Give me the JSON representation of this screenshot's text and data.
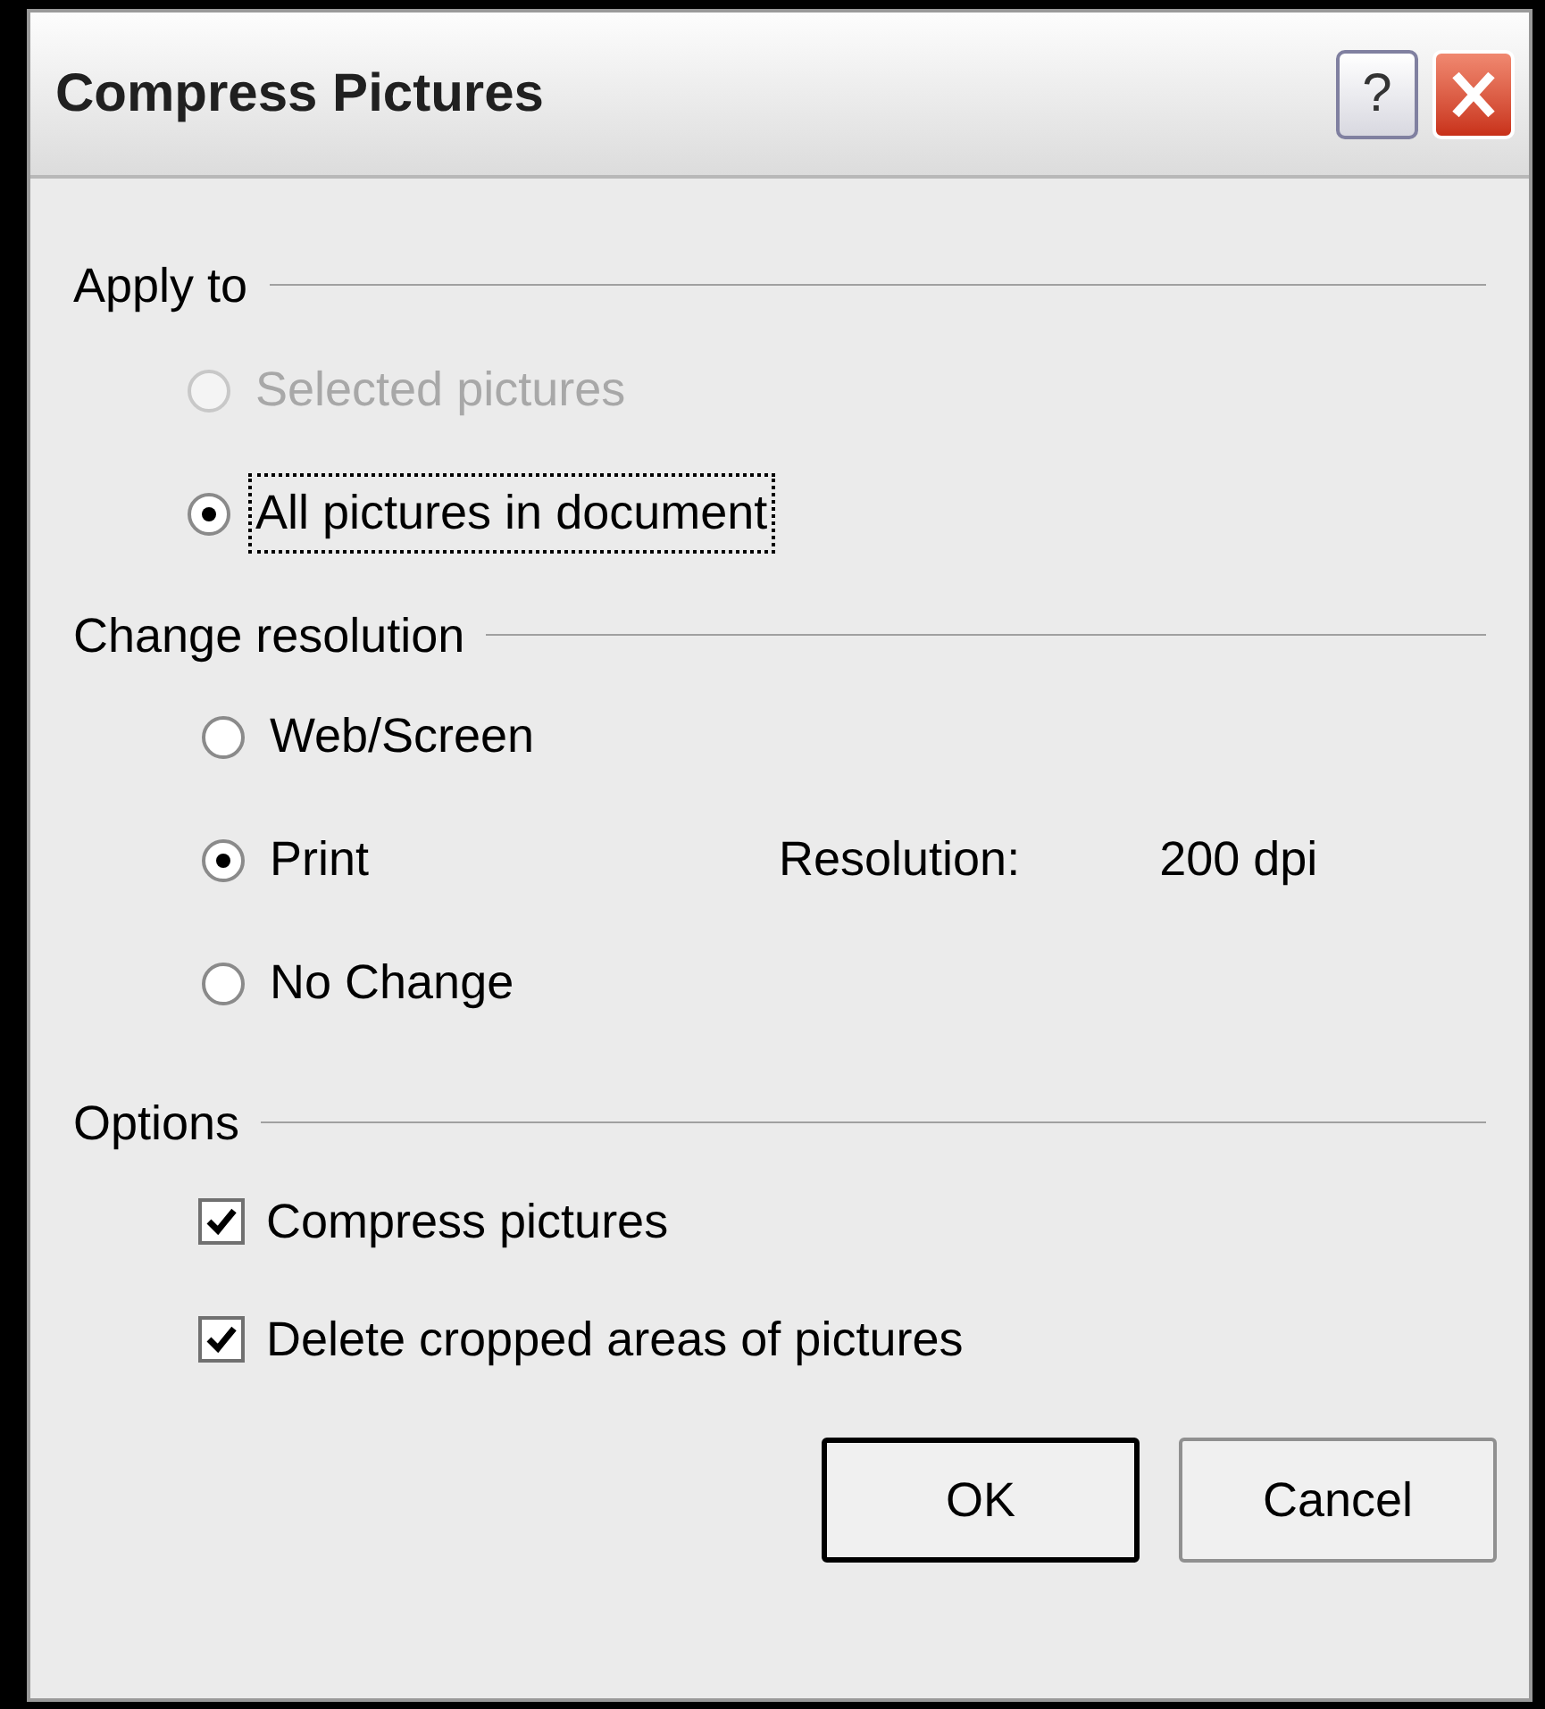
{
  "window": {
    "title": "Compress Pictures",
    "help_button": "?"
  },
  "apply_to": {
    "label": "Apply to",
    "options": [
      {
        "label": "Selected pictures",
        "selected": false,
        "disabled": true,
        "focused": false
      },
      {
        "label": "All pictures in document",
        "selected": true,
        "disabled": false,
        "focused": true
      }
    ]
  },
  "change_resolution": {
    "label": "Change resolution",
    "resolution_label": "Resolution:",
    "resolution_value": "200 dpi",
    "options": [
      {
        "label": "Web/Screen",
        "selected": false,
        "disabled": false,
        "focused": false
      },
      {
        "label": "Print",
        "selected": true,
        "disabled": false,
        "focused": false
      },
      {
        "label": "No Change",
        "selected": false,
        "disabled": false,
        "focused": false
      }
    ]
  },
  "options": {
    "label": "Options",
    "items": [
      {
        "label": "Compress pictures",
        "checked": true
      },
      {
        "label": "Delete cropped areas of pictures",
        "checked": true
      }
    ]
  },
  "buttons": [
    {
      "label": "OK",
      "default": true
    },
    {
      "label": "Cancel",
      "default": false
    }
  ]
}
